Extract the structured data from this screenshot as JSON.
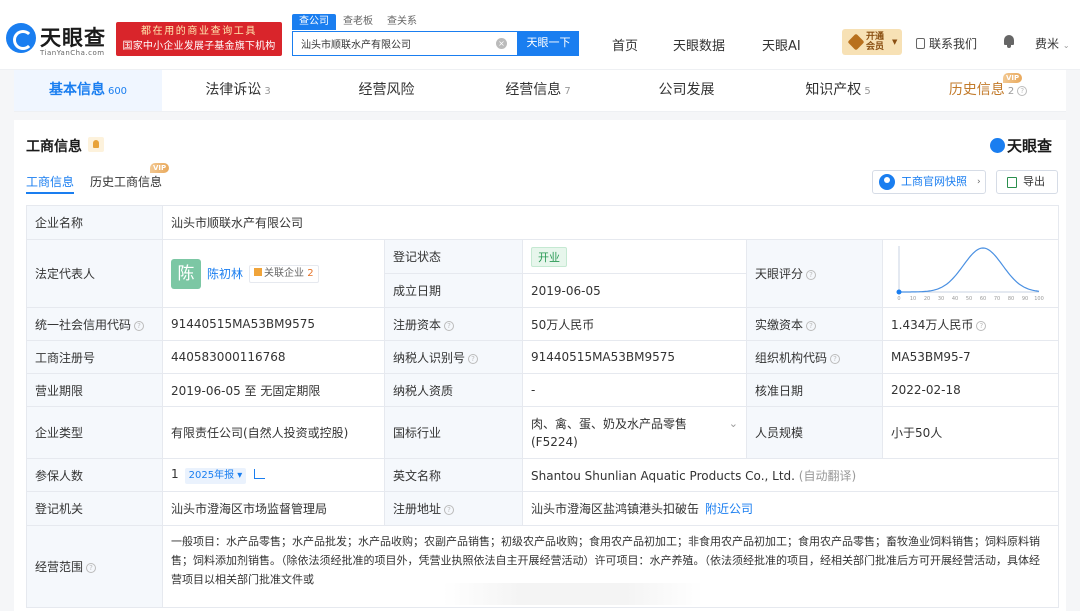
{
  "header": {
    "logo_text": "天眼查",
    "logo_sub": "TianYanCha.com",
    "banner_line1": "都在用的商业查询工具",
    "banner_line2": "国家中小企业发展子基金旗下机构",
    "search_tabs": [
      "查公司",
      "查老板",
      "查关系"
    ],
    "search_value": "汕头市顺联水产有限公司",
    "search_button": "天眼一下",
    "nav": [
      "首页",
      "天眼数据",
      "天眼AI"
    ],
    "vip_line1": "开通",
    "vip_line2": "会员",
    "contact": "联系我们",
    "user": "费米"
  },
  "main_tabs": [
    {
      "label": "基本信息",
      "count": "600"
    },
    {
      "label": "法律诉讼",
      "count": "3"
    },
    {
      "label": "经营风险",
      "count": ""
    },
    {
      "label": "经营信息",
      "count": "7"
    },
    {
      "label": "公司发展",
      "count": ""
    },
    {
      "label": "知识产权",
      "count": "5"
    },
    {
      "label": "历史信息",
      "count": "2"
    }
  ],
  "vip_tag": "VIP",
  "section": {
    "title": "工商信息",
    "brand": "天眼查",
    "subtabs": [
      "工商信息",
      "历史工商信息"
    ],
    "snapshot_button": "工商官网快照",
    "export_button": "导出"
  },
  "company": {
    "name_label": "企业名称",
    "name": "汕头市顺联水产有限公司",
    "legal_label": "法定代表人",
    "legal_avatar": "陈",
    "legal_name": "陈初林",
    "related_label": "关联企业",
    "related_count": "2",
    "reg_status_label": "登记状态",
    "reg_status": "开业",
    "est_date_label": "成立日期",
    "est_date": "2019-06-05",
    "score_label": "天眼评分",
    "credit_code_label": "统一社会信用代码",
    "credit_code": "91440515MA53BM9575",
    "reg_capital_label": "注册资本",
    "reg_capital": "50万人民币",
    "paid_capital_label": "实缴资本",
    "paid_capital": "1.434万人民币",
    "reg_no_label": "工商注册号",
    "reg_no": "440583000116768",
    "tax_id_label": "纳税人识别号",
    "tax_id": "91440515MA53BM9575",
    "org_code_label": "组织机构代码",
    "org_code": "MA53BM95-7",
    "term_label": "营业期限",
    "term": "2019-06-05 至 无固定期限",
    "taxpayer_label": "纳税人资质",
    "taxpayer": "-",
    "approve_date_label": "核准日期",
    "approve_date": "2022-02-18",
    "type_label": "企业类型",
    "type": "有限责任公司(自然人投资或控股)",
    "industry_label": "国标行业",
    "industry": "肉、禽、蛋、奶及水产品零售(F5224)",
    "staff_label": "人员规模",
    "staff": "小于50人",
    "insured_label": "参保人数",
    "insured": "1",
    "insured_year": "2025年报",
    "en_name_label": "英文名称",
    "en_name": "Shantou Shunlian Aquatic Products Co., Ltd.",
    "auto_translate": "(自动翻译)",
    "authority_label": "登记机关",
    "authority": "汕头市澄海区市场监督管理局",
    "address_label": "注册地址",
    "address": "汕头市澄海区盐鸿镇港头扣破缶",
    "nearby": "附近公司",
    "scope_label": "经营范围",
    "scope": "一般项目：水产品零售；水产品批发；水产品收购；农副产品销售；初级农产品收购；食用农产品初加工；非食用农产品初加工；食用农产品零售；畜牧渔业饲料销售；饲料原料销售；饲料添加剂销售。（除依法须经批准的项目外，凭营业执照依法自主开展经营活动）许可项目：水产养殖。（依法须经批准的项目，经相关部门批准后方可开展经营活动，具体经营项目以相关部门批准文件或"
  },
  "score_chart": {
    "x_ticks": [
      "0",
      "10",
      "20",
      "30",
      "40",
      "50",
      "60",
      "70",
      "80",
      "90",
      "100"
    ],
    "marker": 0
  },
  "colors": {
    "brand": "#1a7ef0",
    "banner": "#d9252b",
    "open": "#2a9a55"
  }
}
